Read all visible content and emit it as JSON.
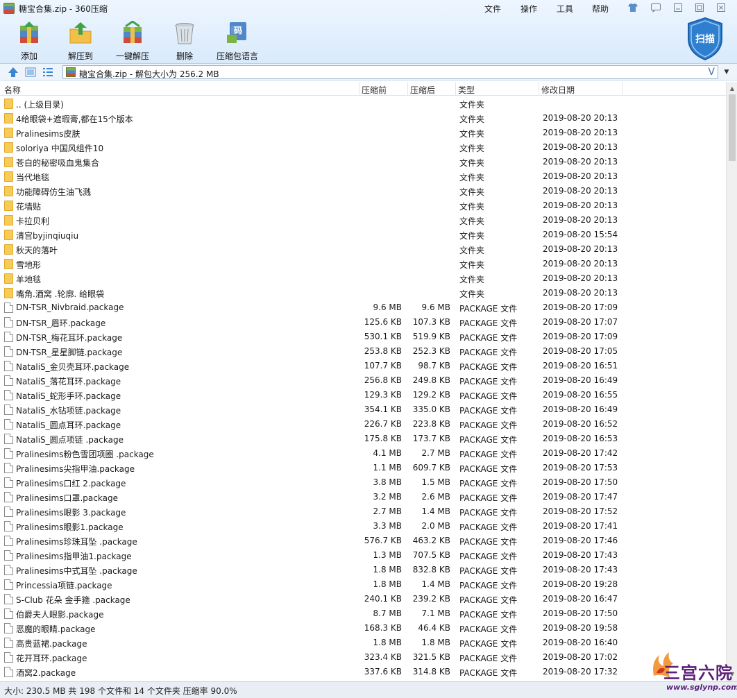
{
  "window": {
    "title": "糖宝合集.zip - 360压缩"
  },
  "menu": [
    "文件",
    "操作",
    "工具",
    "帮助"
  ],
  "toolbar": [
    {
      "label": "添加"
    },
    {
      "label": "解压到"
    },
    {
      "label": "一键解压"
    },
    {
      "label": "删除"
    },
    {
      "label": "压缩包语言"
    }
  ],
  "scan": {
    "label": "扫描"
  },
  "address": {
    "path": "糖宝合集.zip - 解包大小为 256.2 MB",
    "dropdown_glyph": "V"
  },
  "columns": {
    "name": "名称",
    "packed": "压缩前",
    "size": "压缩后",
    "type": "类型",
    "date": "修改日期"
  },
  "rows": [
    {
      "kind": "folder",
      "name": ".. (上级目录)",
      "packed": "",
      "size": "",
      "type": "文件夹",
      "date": ""
    },
    {
      "kind": "folder",
      "name": "4给眼袋+遮瑕膏,都在15个版本",
      "packed": "",
      "size": "",
      "type": "文件夹",
      "date": "2019-08-20 20:13"
    },
    {
      "kind": "folder",
      "name": "Pralinesims皮肤",
      "packed": "",
      "size": "",
      "type": "文件夹",
      "date": "2019-08-20 20:13"
    },
    {
      "kind": "folder",
      "name": "soloriya 中国风组件10",
      "packed": "",
      "size": "",
      "type": "文件夹",
      "date": "2019-08-20 20:13"
    },
    {
      "kind": "folder",
      "name": "苍白的秘密吸血鬼集合",
      "packed": "",
      "size": "",
      "type": "文件夹",
      "date": "2019-08-20 20:13"
    },
    {
      "kind": "folder",
      "name": "当代地毯",
      "packed": "",
      "size": "",
      "type": "文件夹",
      "date": "2019-08-20 20:13"
    },
    {
      "kind": "folder",
      "name": "功能障碍仿生油飞溅",
      "packed": "",
      "size": "",
      "type": "文件夹",
      "date": "2019-08-20 20:13"
    },
    {
      "kind": "folder",
      "name": "花墙贴",
      "packed": "",
      "size": "",
      "type": "文件夹",
      "date": "2019-08-20 20:13"
    },
    {
      "kind": "folder",
      "name": "卡拉贝利",
      "packed": "",
      "size": "",
      "type": "文件夹",
      "date": "2019-08-20 20:13"
    },
    {
      "kind": "folder",
      "name": "清宫byjinqiuqiu",
      "packed": "",
      "size": "",
      "type": "文件夹",
      "date": "2019-08-20 15:54"
    },
    {
      "kind": "folder",
      "name": "秋天的落叶",
      "packed": "",
      "size": "",
      "type": "文件夹",
      "date": "2019-08-20 20:13"
    },
    {
      "kind": "folder",
      "name": "雪地形",
      "packed": "",
      "size": "",
      "type": "文件夹",
      "date": "2019-08-20 20:13"
    },
    {
      "kind": "folder",
      "name": "羊地毯",
      "packed": "",
      "size": "",
      "type": "文件夹",
      "date": "2019-08-20 20:13"
    },
    {
      "kind": "folder",
      "name": "嘴角.酒窝 .轮廓. 给眼袋",
      "packed": "",
      "size": "",
      "type": "文件夹",
      "date": "2019-08-20 20:13"
    },
    {
      "kind": "file",
      "name": "DN-TSR_Nivbraid.package",
      "packed": "9.6 MB",
      "size": "9.6 MB",
      "type": "PACKAGE 文件",
      "date": "2019-08-20 17:09"
    },
    {
      "kind": "file",
      "name": "DN-TSR_眉环.package",
      "packed": "125.6 KB",
      "size": "107.3 KB",
      "type": "PACKAGE 文件",
      "date": "2019-08-20 17:07"
    },
    {
      "kind": "file",
      "name": "DN-TSR_梅花耳环.package",
      "packed": "530.1 KB",
      "size": "519.9 KB",
      "type": "PACKAGE 文件",
      "date": "2019-08-20 17:09"
    },
    {
      "kind": "file",
      "name": "DN-TSR_星星脚链.package",
      "packed": "253.8 KB",
      "size": "252.3 KB",
      "type": "PACKAGE 文件",
      "date": "2019-08-20 17:05"
    },
    {
      "kind": "file",
      "name": "NataliS_金贝壳耳环.package",
      "packed": "107.7 KB",
      "size": "98.7 KB",
      "type": "PACKAGE 文件",
      "date": "2019-08-20 16:51"
    },
    {
      "kind": "file",
      "name": "NataliS_落花耳环.package",
      "packed": "256.8 KB",
      "size": "249.8 KB",
      "type": "PACKAGE 文件",
      "date": "2019-08-20 16:49"
    },
    {
      "kind": "file",
      "name": "NataliS_蛇形手环.package",
      "packed": "129.3 KB",
      "size": "129.2 KB",
      "type": "PACKAGE 文件",
      "date": "2019-08-20 16:55"
    },
    {
      "kind": "file",
      "name": "NataliS_水钻项链.package",
      "packed": "354.1 KB",
      "size": "335.0 KB",
      "type": "PACKAGE 文件",
      "date": "2019-08-20 16:49"
    },
    {
      "kind": "file",
      "name": "NataliS_圆点耳环.package",
      "packed": "226.7 KB",
      "size": "223.8 KB",
      "type": "PACKAGE 文件",
      "date": "2019-08-20 16:52"
    },
    {
      "kind": "file",
      "name": "NataliS_圆点项链 .package",
      "packed": "175.8 KB",
      "size": "173.7 KB",
      "type": "PACKAGE 文件",
      "date": "2019-08-20 16:53"
    },
    {
      "kind": "file",
      "name": "Pralinesims粉色雪团项圈 .package",
      "packed": "4.1 MB",
      "size": "2.7 MB",
      "type": "PACKAGE 文件",
      "date": "2019-08-20 17:42"
    },
    {
      "kind": "file",
      "name": "Pralinesims尖指甲油.package",
      "packed": "1.1 MB",
      "size": "609.7 KB",
      "type": "PACKAGE 文件",
      "date": "2019-08-20 17:53"
    },
    {
      "kind": "file",
      "name": "Pralinesims口红 2.package",
      "packed": "3.8 MB",
      "size": "1.5 MB",
      "type": "PACKAGE 文件",
      "date": "2019-08-20 17:50"
    },
    {
      "kind": "file",
      "name": "Pralinesims口罩.package",
      "packed": "3.2 MB",
      "size": "2.6 MB",
      "type": "PACKAGE 文件",
      "date": "2019-08-20 17:47"
    },
    {
      "kind": "file",
      "name": "Pralinesims眼影 3.package",
      "packed": "2.7 MB",
      "size": "1.4 MB",
      "type": "PACKAGE 文件",
      "date": "2019-08-20 17:52"
    },
    {
      "kind": "file",
      "name": "Pralinesims眼影1.package",
      "packed": "3.3 MB",
      "size": "2.0 MB",
      "type": "PACKAGE 文件",
      "date": "2019-08-20 17:41"
    },
    {
      "kind": "file",
      "name": "Pralinesims珍珠耳坠 .package",
      "packed": "576.7 KB",
      "size": "463.2 KB",
      "type": "PACKAGE 文件",
      "date": "2019-08-20 17:46"
    },
    {
      "kind": "file",
      "name": "Pralinesims指甲油1.package",
      "packed": "1.3 MB",
      "size": "707.5 KB",
      "type": "PACKAGE 文件",
      "date": "2019-08-20 17:43"
    },
    {
      "kind": "file",
      "name": "Pralinesims中式耳坠 .package",
      "packed": "1.8 MB",
      "size": "832.8 KB",
      "type": "PACKAGE 文件",
      "date": "2019-08-20 17:43"
    },
    {
      "kind": "file",
      "name": "Princessia项链.package",
      "packed": "1.8 MB",
      "size": "1.4 MB",
      "type": "PACKAGE 文件",
      "date": "2019-08-20 19:28"
    },
    {
      "kind": "file",
      "name": "S-Club 花朵 金手箍 .package",
      "packed": "240.1 KB",
      "size": "239.2 KB",
      "type": "PACKAGE 文件",
      "date": "2019-08-20 16:47"
    },
    {
      "kind": "file",
      "name": "伯爵夫人眼影.package",
      "packed": "8.7 MB",
      "size": "7.1 MB",
      "type": "PACKAGE 文件",
      "date": "2019-08-20 17:50"
    },
    {
      "kind": "file",
      "name": "恶魔的眼睛.package",
      "packed": "168.3 KB",
      "size": "46.4 KB",
      "type": "PACKAGE 文件",
      "date": "2019-08-20 19:58"
    },
    {
      "kind": "file",
      "name": "高贵蓝裙.package",
      "packed": "1.8 MB",
      "size": "1.8 MB",
      "type": "PACKAGE 文件",
      "date": "2019-08-20 16:40"
    },
    {
      "kind": "file",
      "name": "花开耳环.package",
      "packed": "323.4 KB",
      "size": "321.5 KB",
      "type": "PACKAGE 文件",
      "date": "2019-08-20 17:02"
    },
    {
      "kind": "file",
      "name": "酒窝2.package",
      "packed": "337.6 KB",
      "size": "314.8 KB",
      "type": "PACKAGE 文件",
      "date": "2019-08-20 17:32"
    }
  ],
  "status": {
    "text": "大小: 230.5 MB 共 198 个文件和 14 个文件夹 压缩率 90.0%"
  },
  "watermark": {
    "line1": "三宫六院",
    "line2": "www.sglynp.com"
  },
  "colors": {
    "header_top": "#eef6ff",
    "header_bottom": "#d9eafb",
    "folder": "#f6cb57",
    "shield": "#2f7fd0",
    "status_bg": "#e9eef5"
  }
}
